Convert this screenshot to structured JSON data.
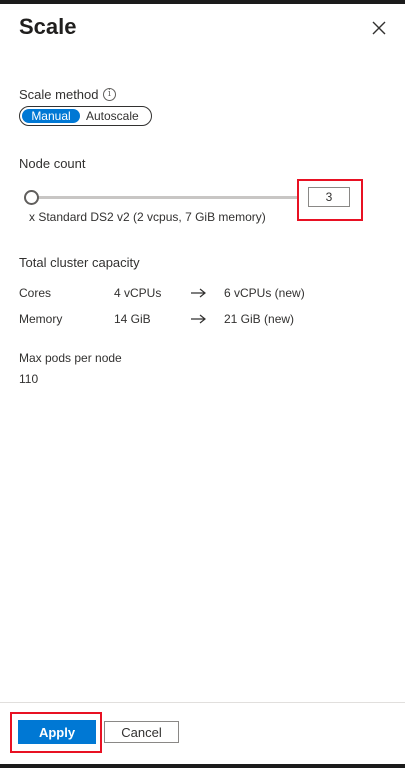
{
  "panel": {
    "title": "Scale"
  },
  "scale_method": {
    "label": "Scale method",
    "info_icon": "i",
    "options": [
      "Manual",
      "Autoscale"
    ],
    "selected": "Manual"
  },
  "node_count": {
    "label": "Node count",
    "value": "3",
    "vm_size": "x Standard DS2 v2 (2 vcpus, 7 GiB memory)"
  },
  "capacity": {
    "title": "Total cluster capacity",
    "rows": [
      {
        "name": "Cores",
        "current": "4 vCPUs",
        "new": "6 vCPUs (new)"
      },
      {
        "name": "Memory",
        "current": "14 GiB",
        "new": "21 GiB (new)"
      }
    ]
  },
  "max_pods": {
    "label": "Max pods per node",
    "value": "110"
  },
  "footer": {
    "apply_label": "Apply",
    "cancel_label": "Cancel"
  },
  "colors": {
    "accent": "#0078d4",
    "highlight": "#e81123"
  },
  "icons": {
    "close": "close-icon",
    "arrow": "arrow-right-icon",
    "info": "info-icon"
  }
}
